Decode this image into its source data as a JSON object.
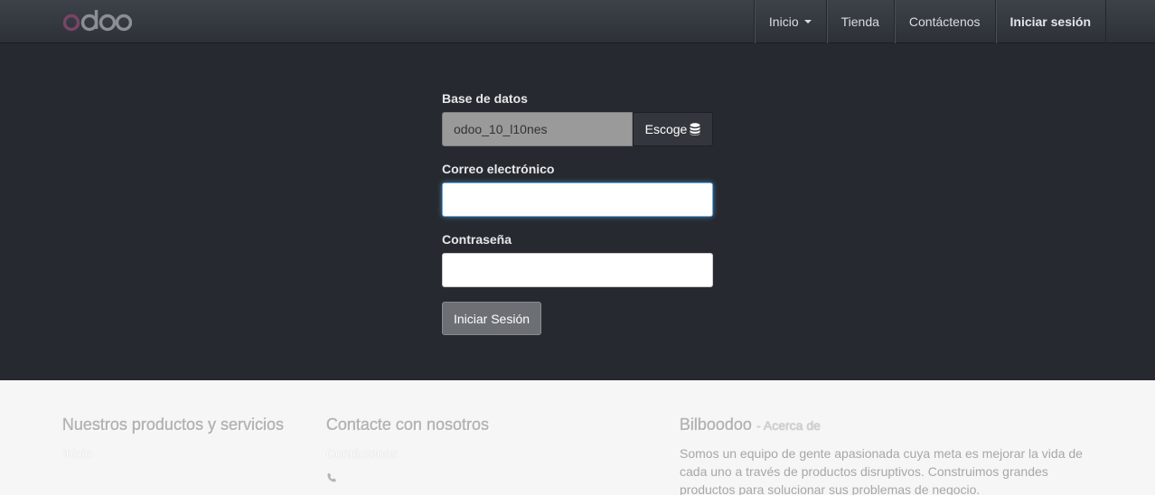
{
  "navbar": {
    "logo_text": "odoo",
    "items": [
      {
        "label": "Inicio",
        "has_caret": true
      },
      {
        "label": "Tienda"
      },
      {
        "label": "Contáctenos"
      },
      {
        "label": "Iniciar sesión",
        "active": true
      }
    ]
  },
  "login": {
    "database_label": "Base de datos",
    "database_value": "odoo_10_l10nes",
    "choose_button": "Escoge",
    "choose_icon": "database-icon",
    "email_label": "Correo electrónico",
    "email_value": "",
    "password_label": "Contraseña",
    "password_value": "",
    "submit_label": "Iniciar Sesión"
  },
  "footer": {
    "col1": {
      "title": "Nuestros productos y servicios",
      "links": [
        "Inicio"
      ]
    },
    "col2": {
      "title": "Contacte con nosotros",
      "links": [
        "Contáctenos"
      ],
      "phone_icon": "phone-icon"
    },
    "col3": {
      "title": "Bilboodoo",
      "subtitle": "- Acerca de",
      "description": "Somos un equipo de gente apasionada cuya meta es mejorar la vida de cada uno a través de productos disruptivos. Construimos grandes productos para solucionar sus problemas de negocio."
    }
  },
  "colors": {
    "navbar_bg": "#353a40",
    "body_bg": "#262a30",
    "footer_bg": "#f6f6f6",
    "focus": "#66afe9"
  }
}
